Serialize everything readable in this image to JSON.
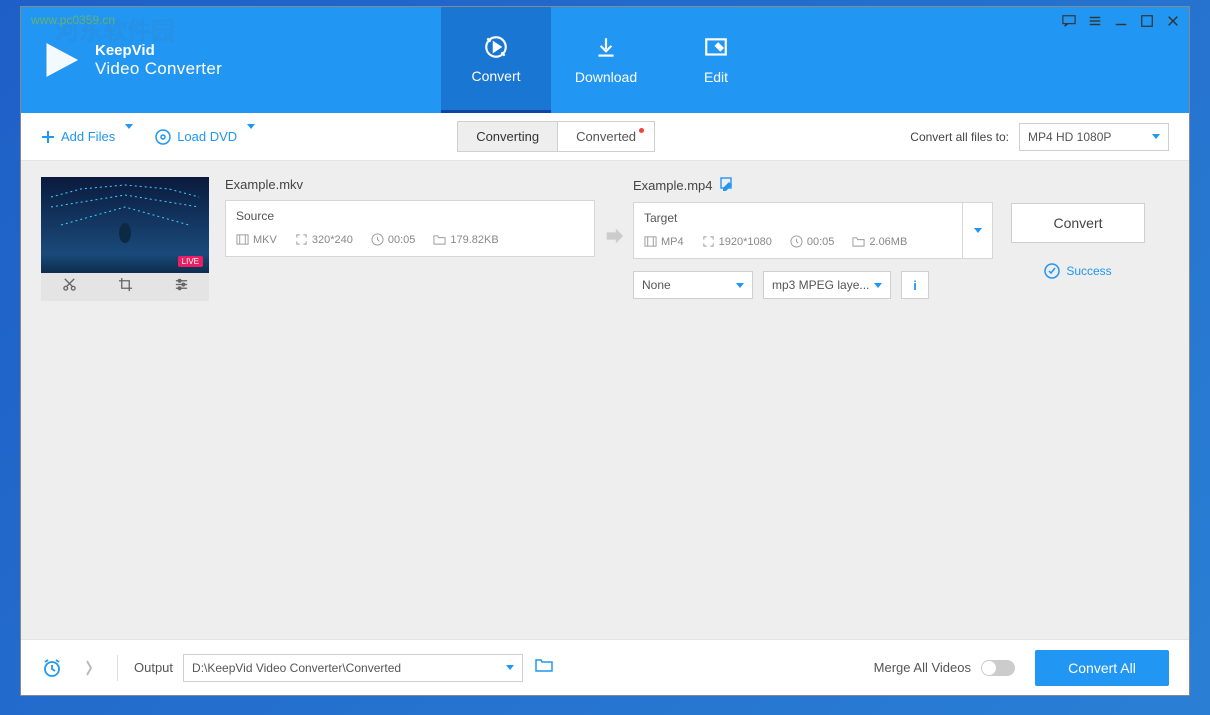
{
  "brand": {
    "name": "KeepVid",
    "sub": "Video Converter"
  },
  "watermark": {
    "url": "www.pc0359.cn",
    "cn": "河东软件园"
  },
  "nav": {
    "convert": "Convert",
    "download": "Download",
    "edit": "Edit"
  },
  "toolbar": {
    "add_files": "Add Files",
    "load_dvd": "Load DVD",
    "toggle_converting": "Converting",
    "toggle_converted": "Converted",
    "convert_all_label": "Convert all files to:",
    "format_selected": "MP4 HD 1080P"
  },
  "item": {
    "source_name": "Example.mkv",
    "source_title": "Source",
    "source_format": "MKV",
    "source_res": "320*240",
    "source_dur": "00:05",
    "source_size": "179.82KB",
    "live_badge": "LIVE",
    "target_name": "Example.mp4",
    "target_title": "Target",
    "target_format": "MP4",
    "target_res": "1920*1080",
    "target_dur": "00:05",
    "target_size": "2.06MB",
    "dd_none": "None",
    "dd_audio": "mp3 MPEG laye...",
    "info_btn": "i",
    "convert_label": "Convert",
    "success_label": "Success"
  },
  "footer": {
    "output_label": "Output",
    "output_path": "D:\\KeepVid Video Converter\\Converted",
    "merge_label": "Merge All Videos",
    "convert_all": "Convert All"
  }
}
